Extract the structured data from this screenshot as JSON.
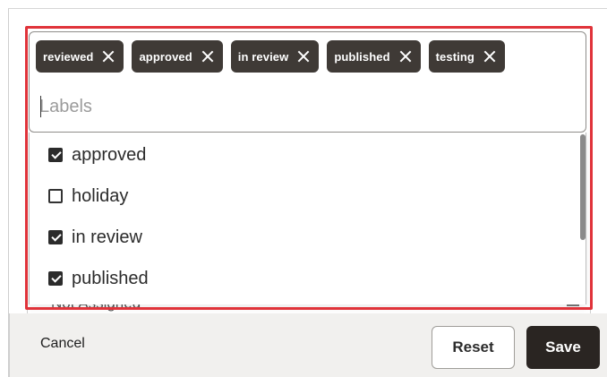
{
  "labels_field": {
    "placeholder": "Labels",
    "selected_chips": [
      {
        "label": "reviewed"
      },
      {
        "label": "approved"
      },
      {
        "label": "in review"
      },
      {
        "label": "published"
      },
      {
        "label": "testing"
      }
    ]
  },
  "dropdown": {
    "options": [
      {
        "label": "approved",
        "checked": true
      },
      {
        "label": "holiday",
        "checked": false
      },
      {
        "label": "in review",
        "checked": true
      },
      {
        "label": "published",
        "checked": true
      }
    ]
  },
  "behind": {
    "partial_text": "Not Assigned"
  },
  "footer": {
    "cancel_label": "Cancel",
    "reset_label": "Reset",
    "save_label": "Save"
  },
  "colors": {
    "highlight": "#e0333a",
    "chip_bg": "#3f3a36",
    "save_bg": "#2a2522",
    "footer_bg": "#f1f0ee"
  },
  "icons": {
    "chip_remove": "close-icon",
    "checkbox_checked": "checkbox-checked-icon",
    "checkbox_unchecked": "checkbox-unchecked-icon"
  }
}
